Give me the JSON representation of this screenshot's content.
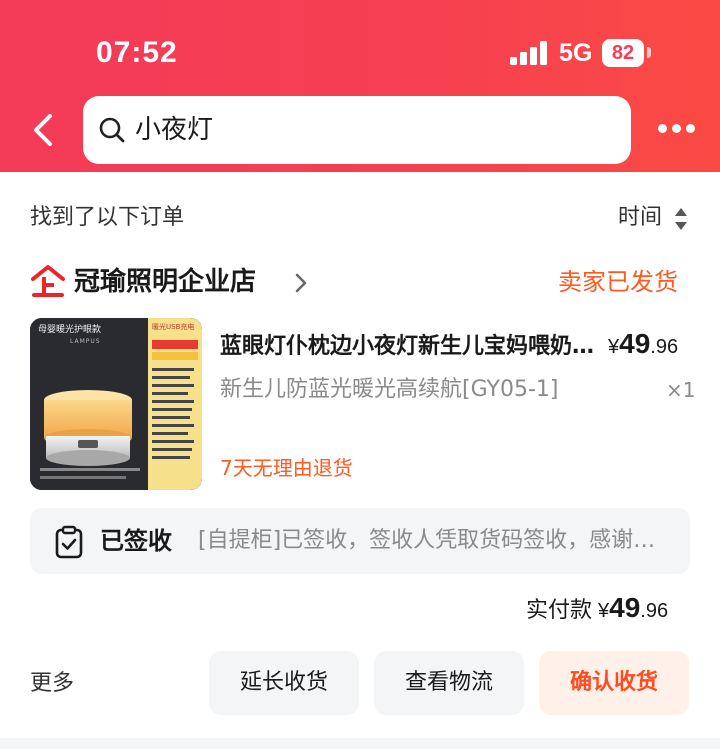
{
  "status_bar": {
    "time": "07:52",
    "network": "5G",
    "battery": "82"
  },
  "header": {
    "search": {
      "query": "小夜灯",
      "icon": "search-icon"
    },
    "back_icon": "chevron-left-icon",
    "more_icon": "more-dots-icon"
  },
  "results": {
    "found_label": "找到了以下订单",
    "sort_label": "时间"
  },
  "order": {
    "store_name": "冠瑜照明企业店",
    "store_icon": "enterprise-store-icon",
    "status": "卖家已发货",
    "product": {
      "title": "蓝眼灯仆枕边小夜灯新生儿宝妈喂奶护眼",
      "variant": "新生儿防蓝光暖光高续航[GY05-1]",
      "qty": "×1",
      "price_currency": "¥",
      "price_int": "49",
      "price_dec": ".96",
      "return_tag": "7天无理由退货",
      "thumb_lettering": {
        "headline": "母婴暖光护眼款",
        "badge": "暖光USB充电",
        "brand": "LAMPUS"
      }
    },
    "logistics": {
      "icon": "clipboard-check-icon",
      "status": "已签收",
      "detail": "[自提柜]已签收，签收人凭取货码签收，感谢使用"
    },
    "paid": {
      "label": "实付款",
      "currency": "¥",
      "int": "49",
      "dec": ".96"
    },
    "actions": {
      "more": "更多",
      "extend": "延长收货",
      "track": "查看物流",
      "confirm": "确认收货"
    }
  },
  "colors": {
    "header_gradient_start": "#f43b58",
    "header_gradient_end": "#fb4a43",
    "accent_orange": "#ff5a1f",
    "confirm_bg": "#fff1ea",
    "muted_text": "#8a8a8a",
    "panel_bg": "#f4f5f7"
  }
}
